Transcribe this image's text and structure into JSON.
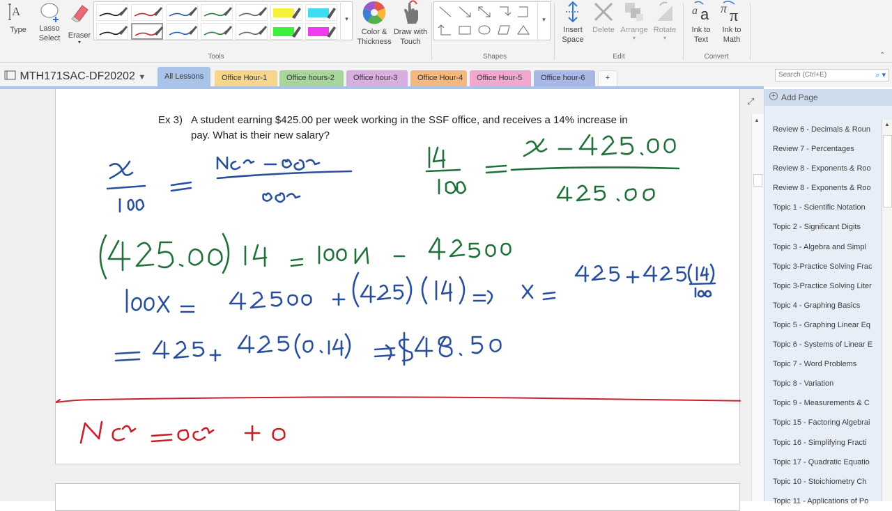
{
  "ribbon": {
    "tools": {
      "type_label": "Type",
      "lasso_label_1": "Lasso",
      "lasso_label_2": "Select",
      "eraser_label": "Eraser",
      "color_label_1": "Color &",
      "color_label_2": "Thickness",
      "draw_touch_label_1": "Draw with",
      "draw_touch_label_2": "Touch",
      "group_label": "Tools"
    },
    "pens": [
      {
        "color": "#1a1a1a"
      },
      {
        "color": "#c0282d"
      },
      {
        "color": "#2f5fa8"
      },
      {
        "color": "#2d7a3a"
      },
      {
        "color": "#666666"
      },
      {
        "color": "#f5f03a",
        "kind": "highlighter"
      },
      {
        "color": "#3fdcf0",
        "kind": "highlighter"
      },
      {
        "color": "#1a1a1a"
      },
      {
        "color": "#c0282d"
      },
      {
        "color": "#2f5fa8"
      },
      {
        "color": "#2d7a3a"
      },
      {
        "color": "#666666"
      },
      {
        "color": "#3cf03c",
        "kind": "highlighter"
      },
      {
        "color": "#f03cf0",
        "kind": "highlighter"
      }
    ],
    "shapes_label": "Shapes",
    "edit": {
      "insert_space_1": "Insert",
      "insert_space_2": "Space",
      "delete_label": "Delete",
      "arrange_label": "Arrange",
      "rotate_label": "Rotate",
      "group_label": "Edit"
    },
    "convert": {
      "ink_text_1": "Ink to",
      "ink_text_2": "Text",
      "ink_math_1": "Ink to",
      "ink_math_2": "Math",
      "group_label": "Convert"
    }
  },
  "notebook": {
    "name": "MTH171SAC-DF20202",
    "tabs": [
      {
        "label": "All Lessons",
        "color": "#a9c4e8",
        "active": true
      },
      {
        "label": "Office Hour-1",
        "color": "#f6d58c"
      },
      {
        "label": "Office hours-2",
        "color": "#a8d59a"
      },
      {
        "label": "Office hour-3",
        "color": "#d8aede"
      },
      {
        "label": "Office Hour-4",
        "color": "#f4b87e"
      },
      {
        "label": "Office Hour-5",
        "color": "#f1a8cf"
      },
      {
        "label": "Office hour-6",
        "color": "#a9b7e6"
      }
    ],
    "add_tab": "+",
    "search_placeholder": "Search (Ctrl+E)"
  },
  "page": {
    "problem_number": "Ex 3)",
    "problem_text": "A student earning $425.00 per week working in the SSF office, and receives a 14% increase in pay. What is their new salary?",
    "ink_colors": {
      "blue": "#2a4f9a",
      "green": "#21703a",
      "red": "#c8202a"
    }
  },
  "pages_pane": {
    "add_page_label": "Add Page",
    "pages": [
      "Review 6 - Decimals & Roun",
      "Review 7 - Percentages",
      "Review 8 - Exponents & Roo",
      "Review 8 - Exponents & Roo",
      "Topic 1 - Scientific Notation",
      "Topic 2 - Significant Digits",
      "Topic 3 - Algebra and Simpl",
      "Topic 3-Practice Solving Frac",
      "Topic 3-Practice Solving Liter",
      "Topic 4 - Graphing Basics",
      "Topic 5 - Graphing Linear Eq",
      "Topic 6 - Systems of Linear E",
      "Topic 7 - Word Problems",
      "Topic 8 - Variation",
      "Topic 9 - Measurements & C",
      "Topic 15 - Factoring Algebrai",
      "Topic 16 - Simplifying Fracti",
      "Topic 17 - Quadratic Equatio",
      "Topic 10 - Stoichiometry Ch",
      "Topic 11 - Applications of Po"
    ]
  }
}
